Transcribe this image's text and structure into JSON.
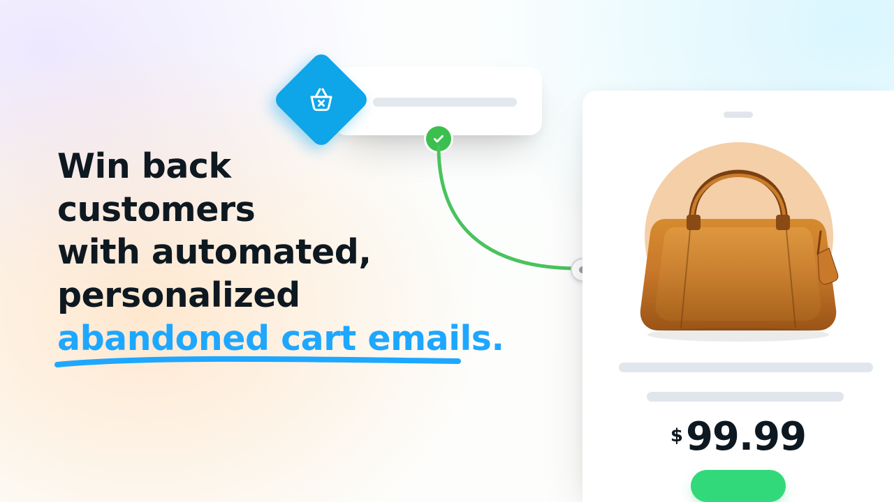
{
  "headline": {
    "line1": "Win back",
    "line2": "customers",
    "line3": "with automated,",
    "line4": "personalized",
    "emphasis": "abandoned cart emails."
  },
  "product": {
    "currency_symbol": "$",
    "price": "99.99"
  },
  "colors": {
    "accent": "#1ea7ff",
    "diamond": "#0ea5e9",
    "success": "#3bbf4e",
    "cta": "#32d97a",
    "flow_stroke": "#4ac25e"
  },
  "icons": {
    "trigger": "basket-x-icon",
    "status": "checkmark-icon"
  }
}
